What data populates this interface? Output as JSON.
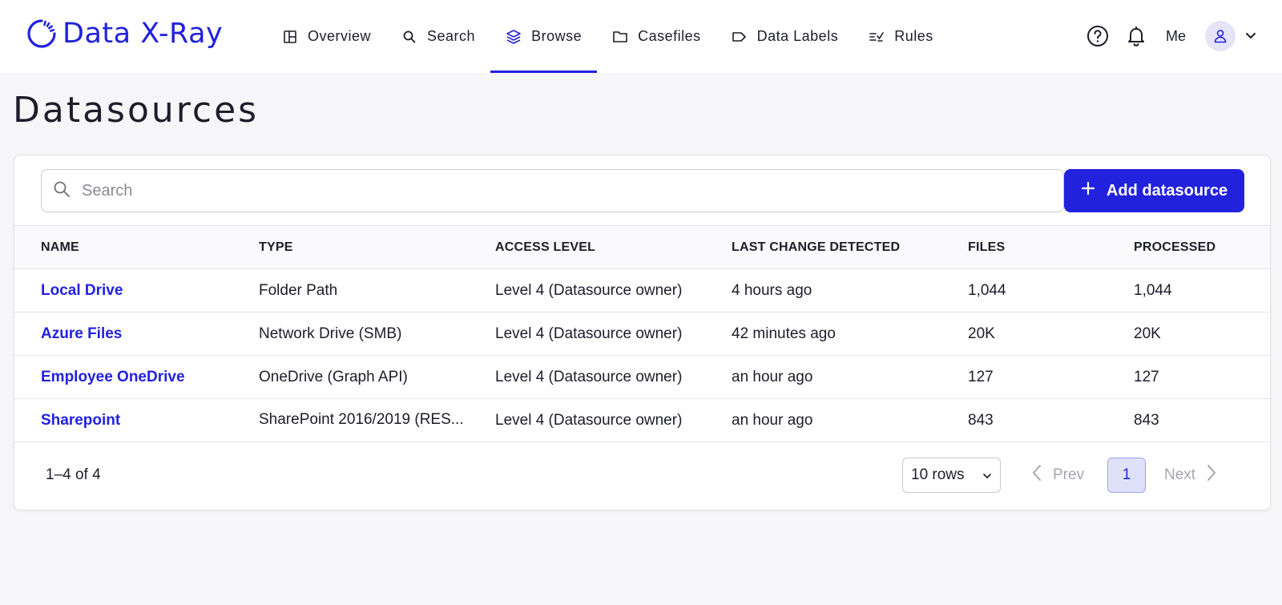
{
  "brand": {
    "name": "Data X-Ray",
    "color": "#2222dd"
  },
  "nav": {
    "items": [
      {
        "label": "Overview",
        "icon": "layout-icon"
      },
      {
        "label": "Search",
        "icon": "search-icon"
      },
      {
        "label": "Browse",
        "icon": "layers-icon",
        "active": true
      },
      {
        "label": "Casefiles",
        "icon": "folder-icon"
      },
      {
        "label": "Data Labels",
        "icon": "tag-icon"
      },
      {
        "label": "Rules",
        "icon": "rules-icon"
      }
    ]
  },
  "user": {
    "label": "Me"
  },
  "page": {
    "title": "Datasources"
  },
  "search": {
    "placeholder": "Search",
    "value": ""
  },
  "add_button": {
    "label": "Add datasource"
  },
  "table": {
    "columns": [
      "NAME",
      "TYPE",
      "ACCESS LEVEL",
      "LAST CHANGE DETECTED",
      "FILES",
      "PROCESSED"
    ],
    "rows": [
      {
        "name": "Local Drive",
        "type": "Folder Path",
        "access": "Level 4 (Datasource owner)",
        "last_change": "4 hours ago",
        "files": "1,044",
        "processed": "1,044"
      },
      {
        "name": "Azure Files",
        "type": "Network Drive (SMB)",
        "access": "Level 4 (Datasource owner)",
        "last_change": "42 minutes ago",
        "files": "20K",
        "processed": "20K"
      },
      {
        "name": "Employee OneDrive",
        "type": "OneDrive (Graph API)",
        "access": "Level 4 (Datasource owner)",
        "last_change": "an hour ago",
        "files": "127",
        "processed": "127"
      },
      {
        "name": "Sharepoint",
        "type": "SharePoint 2016/2019 (RES...",
        "access": "Level 4 (Datasource owner)",
        "last_change": "an hour ago",
        "files": "843",
        "processed": "843"
      }
    ]
  },
  "pagination": {
    "summary": "1–4 of 4",
    "rows_per_page": "10 rows",
    "prev_label": "Prev",
    "current_page": "1",
    "next_label": "Next"
  }
}
